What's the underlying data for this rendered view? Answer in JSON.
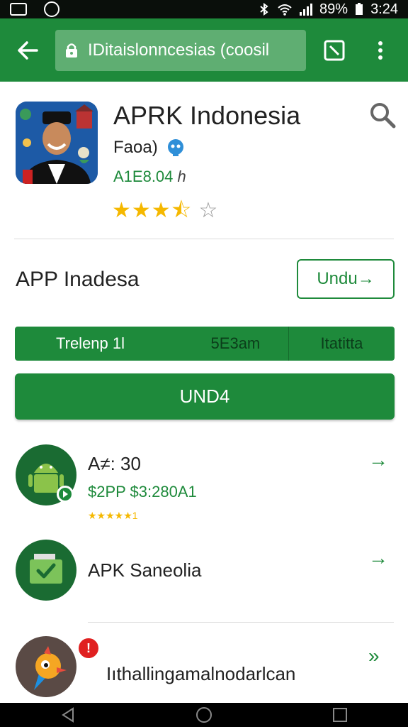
{
  "status_bar": {
    "battery": "89%",
    "time": "3:24"
  },
  "browser": {
    "url": "IDitaislonncesias (coosil"
  },
  "app": {
    "title": "APRK Indonesia",
    "developer": "Faoa)",
    "meta": "A1E8.04",
    "meta_suffix": "h",
    "rating_stars": "★★★⯪",
    "rating_empty": "☆"
  },
  "section": {
    "title": "APP Inadesa",
    "download_label": "Undu→"
  },
  "tabs": [
    {
      "label": "Trelenp 1l"
    },
    {
      "label": "5E3am"
    },
    {
      "label": "Itatitta"
    }
  ],
  "primary_button": {
    "label": "UND4"
  },
  "list": [
    {
      "title": "A≠: 30",
      "subtitle": "$2PP $3:280A1",
      "stars": "★★★★★1",
      "arrow": "→",
      "icon": "android-icon"
    },
    {
      "title": "APK Saneolia",
      "arrow": "→",
      "icon": "check-folder-icon"
    },
    {
      "title": "Iıthallingamalnodarlcan",
      "arrow": "»",
      "icon": "bird-icon",
      "badge": "!"
    }
  ],
  "colors": {
    "primary": "#1e8a3b",
    "status_bar": "#0a0f0b",
    "star": "#f5b800"
  }
}
